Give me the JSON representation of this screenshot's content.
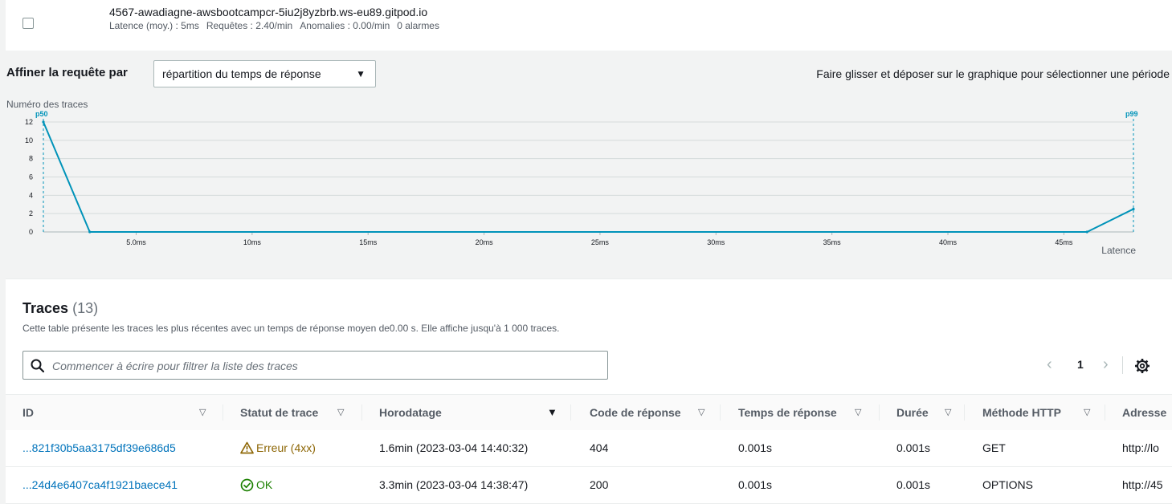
{
  "node": {
    "name": "4567-awadiagne-awsbootcampcr-5iu2j8yzbrb.ws-eu89.gitpod.io",
    "stats": [
      "Latence (moy.) : 5ms",
      "Requêtes : 2.40/min",
      "Anomalies : 0.00/min",
      "0 alarmes"
    ]
  },
  "refine": {
    "label": "Affiner la requête par",
    "selected": "répartition du temps de réponse",
    "hint": "Faire glisser et déposer sur le graphique pour sélectionner une période"
  },
  "chart_data": {
    "type": "line",
    "ylabel": "Numéro des traces",
    "xlabel": "Latence",
    "x_unit": "ms",
    "x": [
      1,
      3,
      46,
      48
    ],
    "values": [
      12,
      0,
      0,
      2.5
    ],
    "ylim": [
      0,
      12
    ],
    "yticks": [
      "0",
      "2",
      "4",
      "6",
      "8",
      "10",
      "12"
    ],
    "ytick_values": [
      0,
      2,
      4,
      6,
      8,
      10,
      12
    ],
    "xticks": [
      "5.0ms",
      "10ms",
      "15ms",
      "20ms",
      "25ms",
      "30ms",
      "35ms",
      "40ms",
      "45ms"
    ],
    "xtick_values": [
      5,
      10,
      15,
      20,
      25,
      30,
      35,
      40,
      45
    ],
    "xlim": [
      1,
      48
    ],
    "markers": [
      {
        "label": "p50",
        "x": 1
      },
      {
        "label": "p99",
        "x": 48
      }
    ],
    "grid": true,
    "color": "#0093b9"
  },
  "traces": {
    "title": "Traces",
    "count": "(13)",
    "description": "Cette table présente les traces les plus récentes avec un temps de réponse moyen de0.00 s. Elle affiche jusqu'à 1 000 traces.",
    "search_placeholder": "Commencer à écrire pour filtrer la liste des traces",
    "search_value": "",
    "page": "1",
    "columns": [
      "ID",
      "Statut de trace",
      "Horodatage",
      "Code de réponse",
      "Temps de réponse",
      "Durée",
      "Méthode HTTP",
      "Adresse"
    ],
    "rows": [
      {
        "id": "...821f30b5aa3175df39e686d5",
        "status": "Erreur (4xx)",
        "status_kind": "error",
        "timestamp": "1.6min (2023-03-04 14:40:32)",
        "code": "404",
        "response_time": "0.001s",
        "duration": "0.001s",
        "method": "GET",
        "address": "http://lo"
      },
      {
        "id": "...24d4e6407ca4f1921baece41",
        "status": "OK",
        "status_kind": "ok",
        "timestamp": "3.3min (2023-03-04 14:38:47)",
        "code": "200",
        "response_time": "0.001s",
        "duration": "0.001s",
        "method": "OPTIONS",
        "address": "http://45"
      }
    ]
  },
  "colors": {
    "link": "#0073bb",
    "error": "#8d6605",
    "ok": "#1d8102",
    "chart_line": "#0093b9"
  }
}
